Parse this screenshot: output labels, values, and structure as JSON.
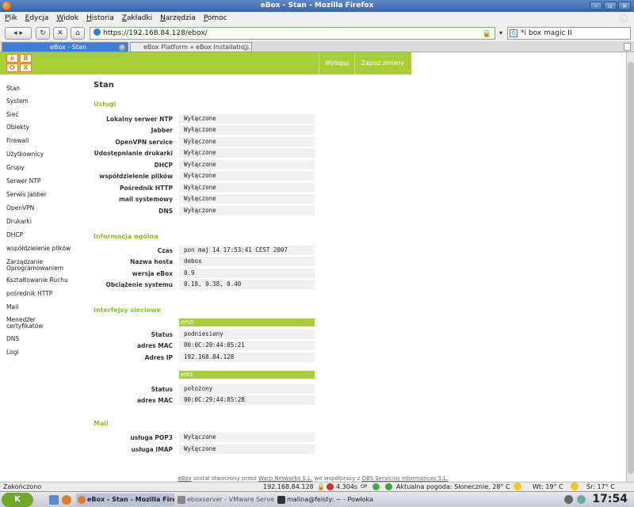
{
  "window": {
    "title": "eBox - Stan - Mozilla Firefox"
  },
  "menu": [
    "Plik",
    "Edycja",
    "Widok",
    "Historia",
    "Zakładki",
    "Narzędzia",
    "Pomoc"
  ],
  "nav": {
    "url": "https://192.168.84.128/ebox/",
    "search": "*i box magic II"
  },
  "tabs": [
    {
      "label": "eBox - Stan",
      "active": true
    },
    {
      "label": "eBox Platform » eBox Installatio...",
      "active": false
    }
  ],
  "header": {
    "logo_letters": [
      "e",
      "B",
      "O",
      "X"
    ],
    "logout": "Wyloguj",
    "save": "Zapisz zmiany"
  },
  "sidebar": [
    "Stan",
    "System",
    "Sieć",
    "Obiekty",
    "Firewall",
    "Użytkownicy",
    "Grupy",
    "Serwer NTP",
    "Serwis Jabber",
    "OpenVPN",
    "Drukarki",
    "DHCP",
    "współdzielenie plików",
    "Zarządzanie Oprogramowaniem",
    "Kształtowanie Ruchu",
    "pośrednik HTTP",
    "Mail",
    "Menedżer certyfikatów",
    "DNS",
    "Logi"
  ],
  "content": {
    "title": "Stan",
    "services_title": "Usługi",
    "services": [
      {
        "label": "Lokalny serwer NTP",
        "value": "Wyłączone"
      },
      {
        "label": "Jabber",
        "value": "Wyłączone"
      },
      {
        "label": "OpenVPN service",
        "value": "Wyłączone"
      },
      {
        "label": "Udostępnianie drukarki",
        "value": "Wyłączone"
      },
      {
        "label": "DHCP",
        "value": "Wyłączone"
      },
      {
        "label": "współdzielenie plików",
        "value": "Wyłączone"
      },
      {
        "label": "Pośrednik HTTP",
        "value": "Wyłączone"
      },
      {
        "label": "mail systemowy",
        "value": "Wyłączone"
      },
      {
        "label": "DNS",
        "value": "Wyłączone"
      }
    ],
    "general_title": "Informacja ogólna",
    "general": [
      {
        "label": "Czas",
        "value": "pon maj 14 17:53:41 CEST 2007"
      },
      {
        "label": "Nazwa hosta",
        "value": "debox"
      },
      {
        "label": "wersja eBox",
        "value": "0.9"
      },
      {
        "label": "Obciążenie systemu",
        "value": "0.18, 0.38, 0.40"
      }
    ],
    "interfaces_title": "Interfejsy sieciowe",
    "interfaces": [
      {
        "name": "eth0",
        "rows": [
          {
            "label": "Status",
            "value": "podniesiony"
          },
          {
            "label": "adres MAC",
            "value": "00:0C:29:44:85:21"
          },
          {
            "label": "Adres IP",
            "value": "192.168.84.128"
          }
        ]
      },
      {
        "name": "eth1",
        "rows": [
          {
            "label": "Status",
            "value": "położony"
          },
          {
            "label": "adres MAC",
            "value": "00:0C:29:44:85:2B"
          }
        ]
      }
    ],
    "mail_title": "Mail",
    "mail": [
      {
        "label": "usługa POP3",
        "value": "Wyłączone"
      },
      {
        "label": "usługa IMAP",
        "value": "Wyłączone"
      }
    ]
  },
  "footer": {
    "ebox": "eBox",
    "t1": " został stworzony przez ",
    "warp": "Warp Networks S.L.",
    "t2": " we współpracy z ",
    "dbs": "DBS Servicios Informaticos S.L."
  },
  "status": {
    "left": "Zakończono",
    "ip": "192.168.84.128",
    "time": "4.304s",
    "op": "OP",
    "weather": "Aktualna pogoda: Słonecznie, 28° C",
    "wt": "Wt: 19° C",
    "sr": "Śr: 17° C"
  },
  "taskbar": {
    "start": "K",
    "tasks": [
      "eBox - Stan - Mozilla Fire",
      "eboxserver - VMware Serve",
      "malina@feisty: ~ - Powłoka"
    ],
    "clock": "17:54"
  }
}
